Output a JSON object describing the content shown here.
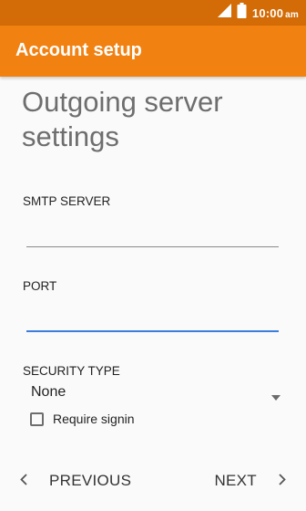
{
  "status_bar": {
    "time": "10:00",
    "ampm": "am",
    "icons": [
      "signal-icon",
      "battery-icon"
    ],
    "color": "#d36b06"
  },
  "app_bar": {
    "title": "Account setup",
    "color": "#f18111"
  },
  "page": {
    "heading": "Outgoing server settings"
  },
  "form": {
    "smtp_server": {
      "label": "SMTP SERVER",
      "value": "",
      "placeholder": ""
    },
    "port": {
      "label": "PORT",
      "value": "",
      "placeholder": "",
      "focused": true
    },
    "security_type": {
      "label": "SECURITY TYPE",
      "selected": "None",
      "icon": "dropdown-arrow-icon"
    },
    "require_signin": {
      "label": "Require signin",
      "checked": false
    }
  },
  "navigation": {
    "previous_label": "PREVIOUS",
    "next_label": "NEXT",
    "previous_icon": "chevron-left-icon",
    "next_icon": "chevron-right-icon"
  },
  "colors": {
    "accent_focus": "#3d7ddb"
  }
}
